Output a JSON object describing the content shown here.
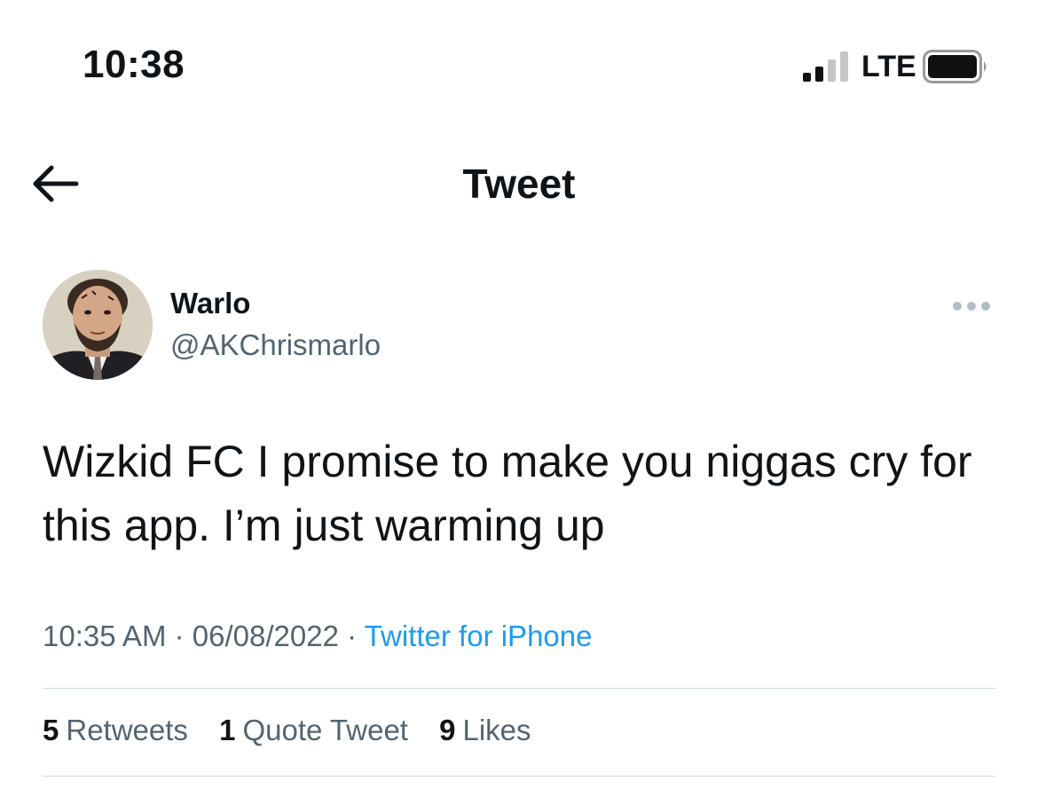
{
  "status_bar": {
    "time": "10:38",
    "network": "LTE",
    "icons": [
      "signal-icon",
      "battery-icon"
    ]
  },
  "nav": {
    "title": "Tweet",
    "back_icon": "back-arrow-icon"
  },
  "tweet": {
    "author": {
      "display_name": "Warlo",
      "handle": "@AKChrismarlo"
    },
    "text": "Wizkid FC I promise to make you niggas cry for this app. I’m just warming up",
    "time": "10:35 AM",
    "date": "06/08/2022",
    "separator": "·",
    "source": "Twitter for iPhone",
    "stats": {
      "retweets_count": "5",
      "retweets_label": "Retweets",
      "quotes_count": "1",
      "quotes_label": "Quote Tweet",
      "likes_count": "9",
      "likes_label": "Likes"
    }
  },
  "colors": {
    "link": "#1d9bf0",
    "secondary_text": "#536471",
    "primary_text": "#0f1419",
    "divider": "#cfd9de"
  }
}
